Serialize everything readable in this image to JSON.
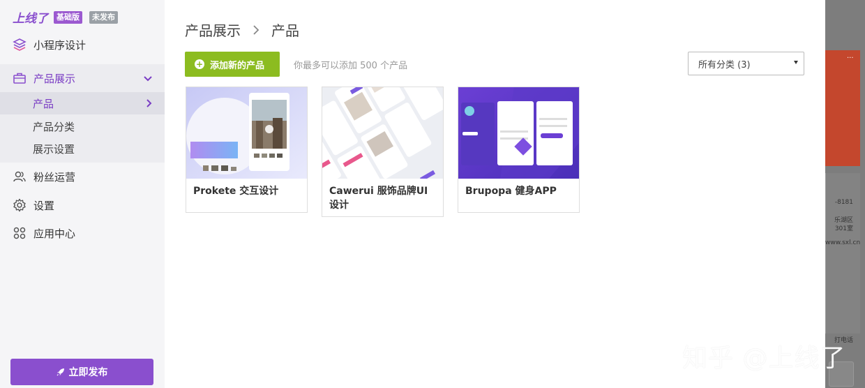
{
  "brand": {
    "logo": "上线了",
    "edition_badge": "基础版",
    "status_badge": "未发布"
  },
  "sidebar": {
    "items": [
      {
        "label": "小程序设计",
        "icon": "layers-icon"
      },
      {
        "label": "产品展示",
        "icon": "briefcase-icon",
        "expanded": true
      },
      {
        "label": "粉丝运营",
        "icon": "users-icon"
      },
      {
        "label": "设置",
        "icon": "gear-icon"
      },
      {
        "label": "应用中心",
        "icon": "apps-grid-icon"
      }
    ],
    "sub_items": [
      {
        "label": "产品",
        "active": true
      },
      {
        "label": "产品分类",
        "active": false
      },
      {
        "label": "展示设置",
        "active": false
      }
    ],
    "publish_label": "立即发布"
  },
  "main": {
    "breadcrumb": [
      "产品展示",
      "产品"
    ],
    "add_button_label": "添加新的产品",
    "hint": "你最多可以添加 500 个产品",
    "category_select": {
      "selected": "所有分类 (3)"
    },
    "products": [
      {
        "title": "Prokete 交互设计"
      },
      {
        "title": "Cawerui 服饰品牌UI 设计"
      },
      {
        "title": "Brupopa 健身APP"
      }
    ]
  },
  "background": {
    "phone_fragment": "-8181",
    "district_fragment": "乐湖区",
    "room_fragment": "301室",
    "url_fragment": "www.sxl.cn",
    "call_fragment": "打电话"
  },
  "watermark": "知乎 @上线了",
  "colors": {
    "accent": "#8a4fce",
    "add_button": "#8cbc20",
    "sidebar_bg": "#f5f5f7"
  }
}
